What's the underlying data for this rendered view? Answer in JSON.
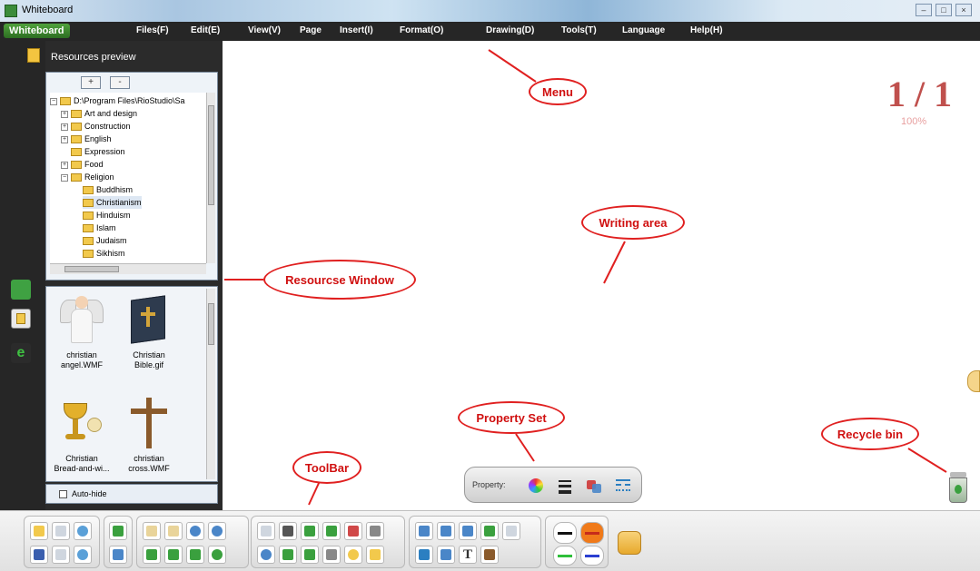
{
  "window": {
    "title": "Whiteboard"
  },
  "menubar": {
    "brand": "Whiteboard",
    "items": [
      "Files(F)",
      "Edit(E)",
      "View(V)",
      "Page",
      "Insert(I)",
      "Format(O)",
      "Drawing(D)",
      "Tools(T)",
      "Language",
      "Help(H)"
    ]
  },
  "resources": {
    "title": "Resources preview",
    "add_label": "+",
    "remove_label": "-",
    "tree": [
      {
        "label": "D:\\Program Files\\RioStudio\\Sa"
      },
      {
        "label": "Art and design"
      },
      {
        "label": "Construction"
      },
      {
        "label": "English"
      },
      {
        "label": "Expression"
      },
      {
        "label": "Food"
      },
      {
        "label": "Religion"
      },
      {
        "label": "Buddhism"
      },
      {
        "label": "Christianism"
      },
      {
        "label": "Hinduism"
      },
      {
        "label": "Islam"
      },
      {
        "label": "Judaism"
      },
      {
        "label": "Sikhism"
      }
    ],
    "thumbnails": [
      {
        "caption": "christian angel.WMF"
      },
      {
        "caption": "Christian Bible.gif"
      },
      {
        "caption": "Christian Bread-and-wi..."
      },
      {
        "caption": "christian cross.WMF"
      }
    ],
    "autohide_label": "Auto-hide"
  },
  "canvas": {
    "page_indicator": "1 / 1",
    "zoom": "100%"
  },
  "property_bar": {
    "label": "Property:"
  },
  "annotations": {
    "menu": "Menu",
    "writing_area": "Writing area",
    "resource_window": "Resourcse Window",
    "property_set": "Property Set",
    "recycle_bin": "Recycle bin",
    "toolbar": "ToolBar"
  },
  "colors": {
    "accent_red": "#e02020",
    "menu_bg": "#262626",
    "brand_green": "#3f8f31"
  }
}
